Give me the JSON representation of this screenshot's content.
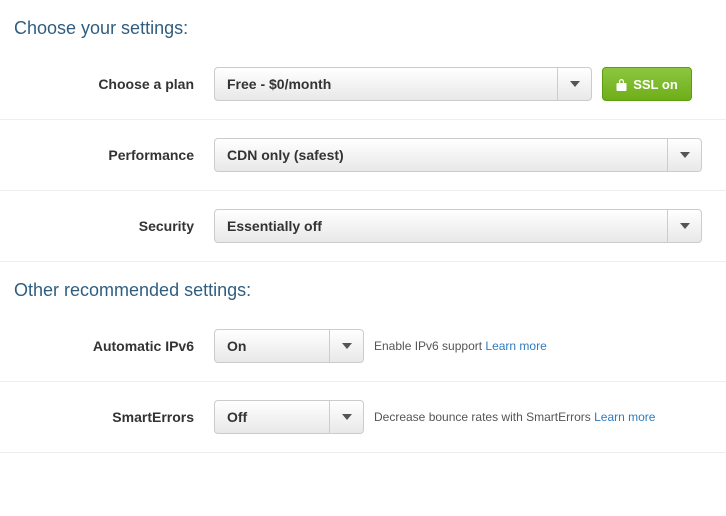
{
  "sections": {
    "choose_title": "Choose your settings:",
    "other_title": "Other recommended settings:"
  },
  "plan": {
    "label": "Choose a plan",
    "value": "Free - $0/month"
  },
  "ssl": {
    "label": "SSL on"
  },
  "performance": {
    "label": "Performance",
    "value": "CDN only (safest)"
  },
  "security": {
    "label": "Security",
    "value": "Essentially off"
  },
  "ipv6": {
    "label": "Automatic IPv6",
    "value": "On",
    "desc": "Enable IPv6 support ",
    "link": "Learn more"
  },
  "smarterrors": {
    "label": "SmartErrors",
    "value": "Off",
    "desc": "Decrease bounce rates with SmartErrors ",
    "link": "Learn more"
  }
}
